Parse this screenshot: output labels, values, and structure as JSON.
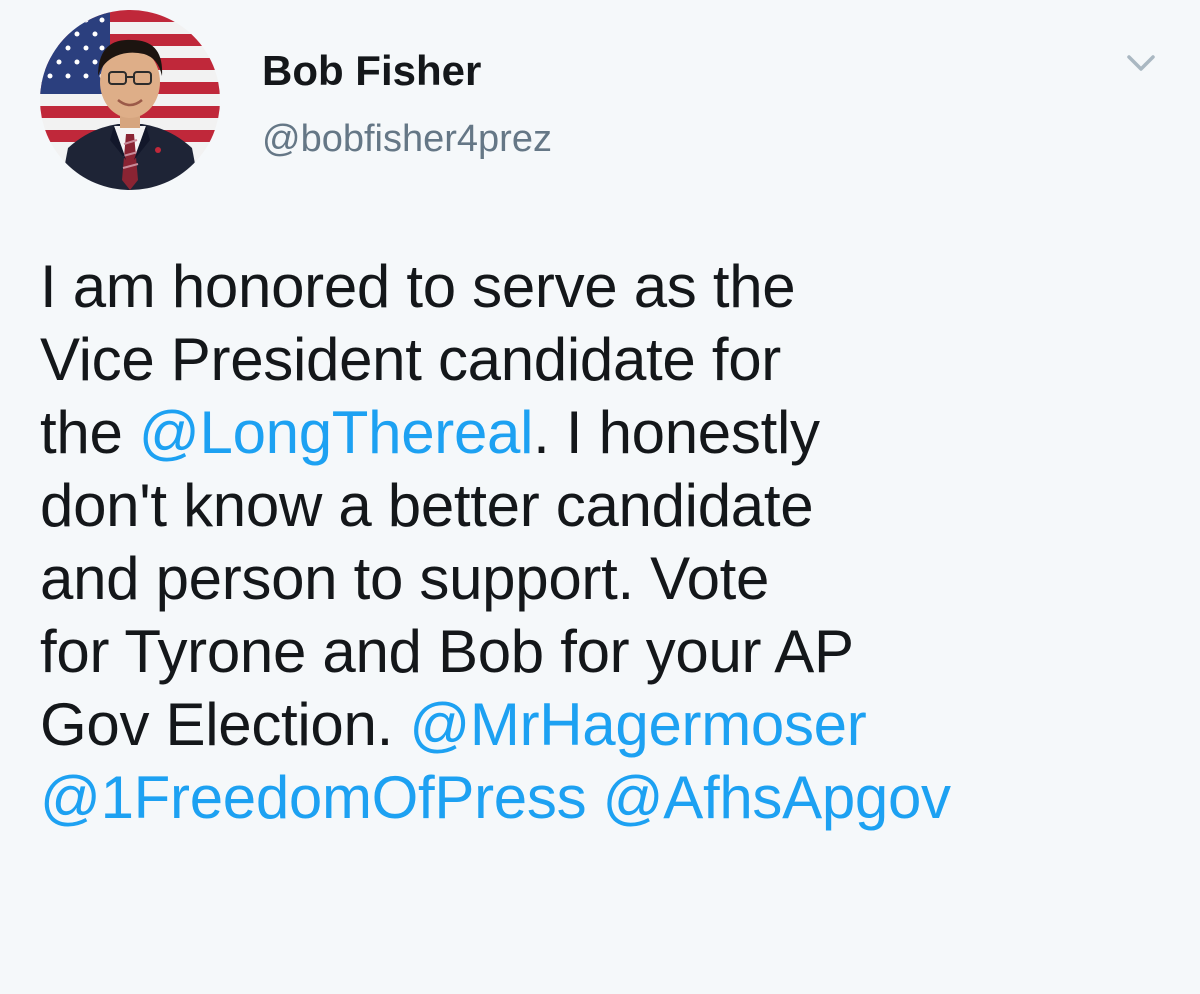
{
  "tweet": {
    "display_name": "Bob Fisher",
    "handle": "@bobfisher4prez",
    "menu_icon": "chevron-down-icon",
    "avatar_icon": "profile-photo",
    "colors": {
      "background": "#f5f8fa",
      "text": "#14171a",
      "secondary": "#657786",
      "mention": "#1da1f2",
      "caret": "#aab8c2"
    },
    "lines": [
      [
        {
          "t": "I am honored to serve as the"
        }
      ],
      [
        {
          "t": "Vice President candidate for"
        }
      ],
      [
        {
          "t": "the "
        },
        {
          "t": "@LongThereal",
          "mention": true
        },
        {
          "t": ". I honestly"
        }
      ],
      [
        {
          "t": "don't know a better candidate"
        }
      ],
      [
        {
          "t": "and person to support. Vote"
        }
      ],
      [
        {
          "t": "for Tyrone and Bob for your AP"
        }
      ],
      [
        {
          "t": "Gov Election. "
        },
        {
          "t": "@MrHagermoser",
          "mention": true
        }
      ],
      [
        {
          "t": "@1FreedomOfPress",
          "mention": true
        },
        {
          "t": " "
        },
        {
          "t": "@AfhsApgov",
          "mention": true
        }
      ]
    ]
  }
}
